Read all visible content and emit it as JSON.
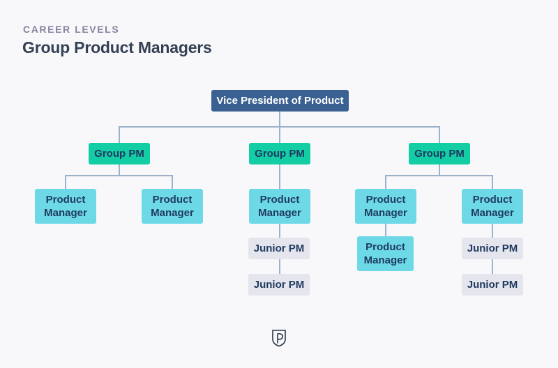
{
  "header": {
    "eyebrow": "CAREER LEVELS",
    "title": "Group Product Managers"
  },
  "colors": {
    "vp": "#3a6191",
    "group_pm": "#13cda5",
    "product_manager": "#6dd9e6",
    "junior_pm": "#e5e5ee",
    "connector": "#9bb1cc",
    "text_dark": "#1f3a5f"
  },
  "org_chart": {
    "root": {
      "label": "Vice President of Product"
    },
    "groups": [
      {
        "label": "Group PM",
        "reports": [
          {
            "label": "Product Manager",
            "reports": []
          },
          {
            "label": "Product Manager",
            "reports": []
          }
        ]
      },
      {
        "label": "Group PM",
        "reports": [
          {
            "label": "Product Manager",
            "reports": [
              {
                "label": "Junior PM"
              },
              {
                "label": "Junior PM"
              }
            ]
          }
        ]
      },
      {
        "label": "Group PM",
        "reports": [
          {
            "label": "Product Manager",
            "reports": [
              {
                "label": "Product Manager"
              }
            ]
          },
          {
            "label": "Product Manager",
            "reports": [
              {
                "label": "Junior PM"
              },
              {
                "label": "Junior PM"
              }
            ]
          }
        ]
      }
    ]
  },
  "footer": {
    "logo_icon": "shield-p-logo-icon"
  }
}
